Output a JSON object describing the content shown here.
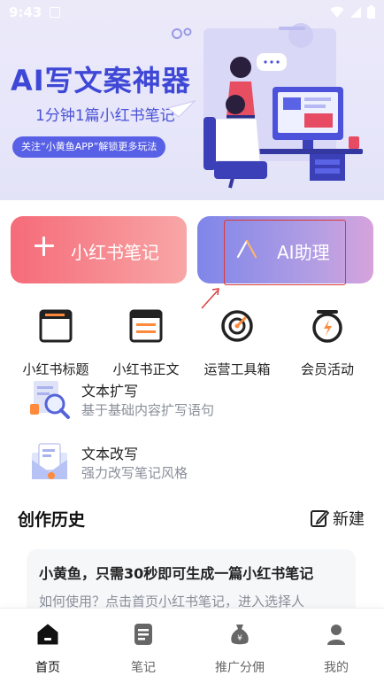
{
  "status_bar": {
    "time": "9:43"
  },
  "banner": {
    "title": "AI写文案神器",
    "subtitle": "1分钟1篇小红书笔记",
    "promo": "关注“小黄鱼APP”解锁更多玩法"
  },
  "actions": {
    "note_label": "小红书笔记",
    "ai_label": "AI助理"
  },
  "tools": [
    {
      "label": "小红书标题",
      "icon": "title-doc-icon"
    },
    {
      "label": "小红书正文",
      "icon": "body-doc-icon"
    },
    {
      "label": "运营工具箱",
      "icon": "target-icon"
    },
    {
      "label": "会员活动",
      "icon": "alarm-clock-icon"
    }
  ],
  "features": [
    {
      "title": "文本扩写",
      "desc": "基于基础内容扩写语句",
      "icon": "magnifier-doc-icon"
    },
    {
      "title": "文本改写",
      "desc": "强力改写笔记风格",
      "icon": "envelope-doc-icon"
    }
  ],
  "history": {
    "title": "创作历史",
    "new_label": "新建",
    "card": {
      "title": "小黄鱼，只需30秒即可生成一篇小红书笔记",
      "body": "如何使用？点击首页小红书笔记，进入选择人"
    }
  },
  "tabs": [
    {
      "label": "首页",
      "icon": "home-icon",
      "active": true
    },
    {
      "label": "笔记",
      "icon": "notes-icon",
      "active": false
    },
    {
      "label": "推广分佣",
      "icon": "money-bag-icon",
      "active": false
    },
    {
      "label": "我的",
      "icon": "profile-icon",
      "active": false
    }
  ],
  "colors": {
    "brand_blue": "#3f48d6",
    "note_button": "#f56b79",
    "ai_button": "#8f8ee8",
    "highlight": "#d93a3a"
  }
}
